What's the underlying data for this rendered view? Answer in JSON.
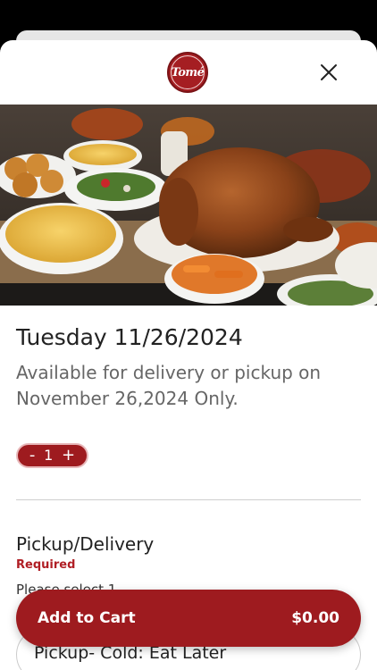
{
  "header": {
    "logo_text": "Tomé",
    "close_icon": "close-icon"
  },
  "hero": {
    "image_icon": "thanksgiving-meal-photo"
  },
  "item": {
    "title": "Tuesday 11/26/2024",
    "description": "Available for delivery or pickup on November 26,2024 Only."
  },
  "quantity": {
    "minus": "-",
    "value": "1",
    "plus": "+"
  },
  "options": {
    "section_title": "Pickup/Delivery",
    "required_label": "Required",
    "placeholder": "Please select 1",
    "selected": "Pickup- Cold: Eat Later"
  },
  "cart": {
    "label": "Add to Cart",
    "price": "$0.00"
  },
  "colors": {
    "brand": "#9e1b1f",
    "required": "#b01e24"
  }
}
